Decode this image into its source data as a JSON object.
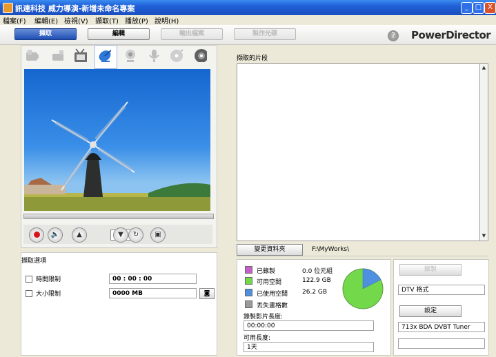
{
  "window": {
    "title": "訊連科技 威力導演-新增未命名專案",
    "minimize": "_",
    "maximize": "□",
    "close": "X"
  },
  "menu": [
    "檔案(F)",
    "編輯(E)",
    "檢視(V)",
    "擷取(T)",
    "播放(P)",
    "說明(H)"
  ],
  "toolbar": {
    "capture": "擷取",
    "edit": "編輯",
    "produce": "輸出檔案",
    "burn": "製作光碟",
    "help": "?",
    "brand": "PowerDirector"
  },
  "controls": {
    "counter": "001"
  },
  "options": {
    "title": "擷取選項",
    "time_limit_label": "時間限制",
    "time_limit_value": "00 : 00 : 00",
    "size_limit_label": "大小限制",
    "size_limit_value": "0000 MB"
  },
  "clips": {
    "label": "擷取的片段",
    "change_folder": "變更資料夾",
    "folder_path": "F:\\MyWorks\\"
  },
  "disk": {
    "recorded_label": "已錄製",
    "recorded_value": "0.0 位元組",
    "free_label": "可用空間",
    "free_value": "122.9 GB",
    "used_label": "已使用空間",
    "used_value": "26.2 GB",
    "dropped_label": "丟失畫格數",
    "rec_length_label": "錄製影片長度:",
    "rec_length_value": "00:00:00",
    "avail_length_label": "可用長度:",
    "avail_length_value": "1天",
    "colors": {
      "recorded": "#c45fc9",
      "free": "#74d94a",
      "used": "#4f8fdf",
      "dropped": "#9a9a9a"
    }
  },
  "settings": {
    "record_button": "錄製",
    "format_value": "DTV 格式",
    "settings_button": "設定",
    "tuner_value": "713x BDA DVBT Tuner"
  }
}
